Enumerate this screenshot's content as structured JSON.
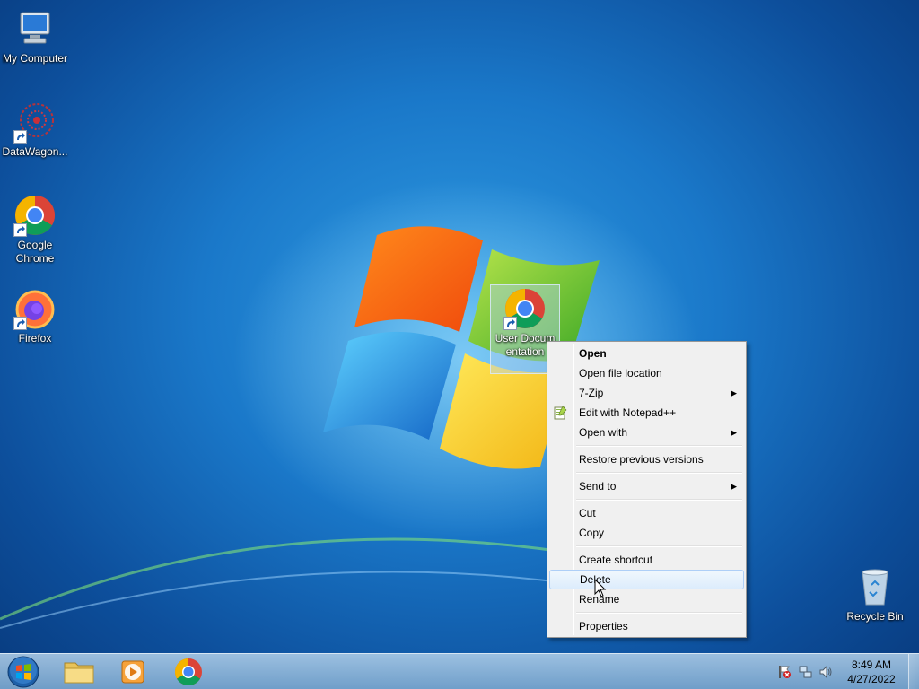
{
  "desktop": {
    "icons": [
      {
        "label": "My Computer",
        "icon": "computer-icon"
      },
      {
        "label": "DataWagon...",
        "icon": "datawagon-icon"
      },
      {
        "label": "Google Chrome",
        "icon": "chrome-icon"
      },
      {
        "label": "Firefox",
        "icon": "firefox-icon"
      },
      {
        "label": "User Documentation",
        "icon": "chrome-icon"
      },
      {
        "label": "Recycle Bin",
        "icon": "recycle-bin-icon"
      }
    ]
  },
  "context_menu": {
    "items": [
      {
        "label": "Open",
        "bold": true
      },
      {
        "label": "Open file location"
      },
      {
        "label": "7-Zip",
        "submenu": true
      },
      {
        "label": "Edit with Notepad++",
        "icon": "notepad-plus-plus-icon"
      },
      {
        "label": "Open with",
        "submenu": true
      },
      {
        "label": "Restore previous versions"
      },
      {
        "label": "Send to",
        "submenu": true
      },
      {
        "label": "Cut"
      },
      {
        "label": "Copy"
      },
      {
        "label": "Create shortcut"
      },
      {
        "label": "Delete",
        "hovered": true
      },
      {
        "label": "Rename"
      },
      {
        "label": "Properties"
      }
    ],
    "submenu_arrow": "▶"
  },
  "taskbar": {
    "pinned": [
      {
        "name": "Windows Explorer",
        "icon": "folder-icon"
      },
      {
        "name": "Windows Media Player",
        "icon": "media-player-icon"
      },
      {
        "name": "Google Chrome",
        "icon": "chrome-icon"
      }
    ],
    "clock": {
      "time": "8:49 AM",
      "date": "4/27/2022"
    },
    "tray_icons": [
      "action-center-flag-icon",
      "network-icon",
      "volume-icon"
    ]
  },
  "colors": {
    "accent": "#1a78c9",
    "menu_bg": "#f0f0f0",
    "menu_hover_border": "#aecff7"
  }
}
